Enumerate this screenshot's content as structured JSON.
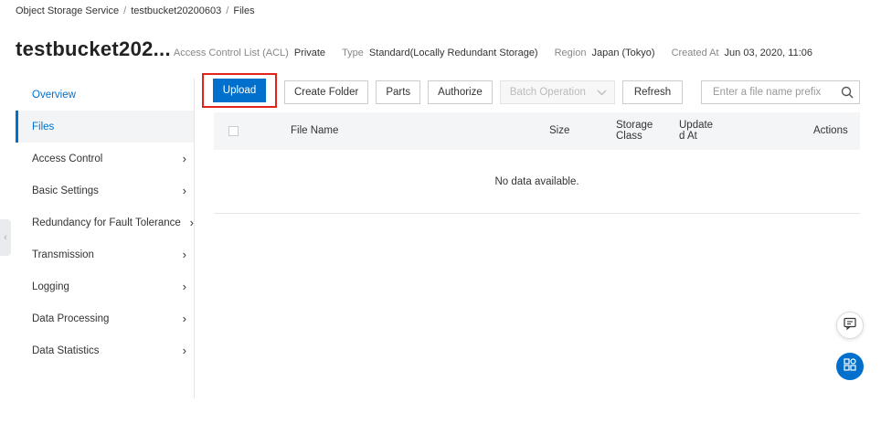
{
  "breadcrumb": [
    "Object Storage Service",
    "testbucket20200603",
    "Files"
  ],
  "header": {
    "title": "testbucket202...",
    "meta": [
      {
        "key": "Access Control List (ACL)",
        "value": "Private"
      },
      {
        "key": "Type",
        "value": "Standard(Locally Redundant Storage)"
      },
      {
        "key": "Region",
        "value": "Japan (Tokyo)"
      },
      {
        "key": "Created At",
        "value": "Jun 03, 2020, 11:06"
      }
    ]
  },
  "sidebar": {
    "items": [
      {
        "label": "Overview"
      },
      {
        "label": "Files"
      },
      {
        "label": "Access Control"
      },
      {
        "label": "Basic Settings"
      },
      {
        "label": "Redundancy for Fault Tolerance"
      },
      {
        "label": "Transmission"
      },
      {
        "label": "Logging"
      },
      {
        "label": "Data Processing"
      },
      {
        "label": "Data Statistics"
      }
    ]
  },
  "toolbar": {
    "upload": "Upload",
    "create_folder": "Create Folder",
    "parts": "Parts",
    "authorize": "Authorize",
    "batch_operation": "Batch Operation",
    "refresh": "Refresh"
  },
  "search": {
    "placeholder": "Enter a file name prefix"
  },
  "table": {
    "columns": {
      "file_name": "File Name",
      "size": "Size",
      "storage_class_1": "Storage",
      "storage_class_2": "Class",
      "updated_at_1": "Update",
      "updated_at_2": "d At",
      "actions": "Actions"
    },
    "empty_text": "No data available."
  },
  "colors": {
    "accent": "#0070cc",
    "highlight": "#e2231a"
  }
}
